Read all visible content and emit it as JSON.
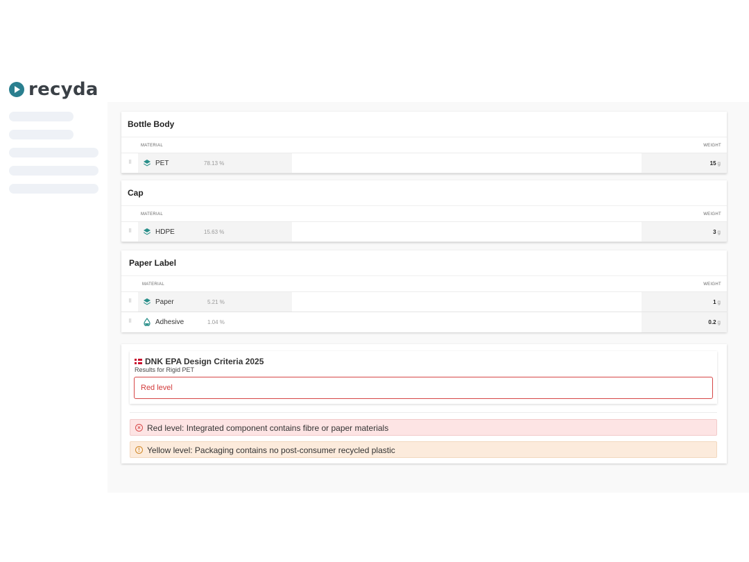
{
  "brand": {
    "name": "recyda",
    "accent": "#2a7f8f"
  },
  "components": [
    {
      "title": "Bottle Body",
      "material_header": "MATERIAL",
      "weight_header": "WEIGHT",
      "rows": [
        {
          "icon": "layers-icon",
          "name": "PET",
          "pct": "78.13 %",
          "weight": "15",
          "unit": "g"
        }
      ]
    },
    {
      "title": "Cap",
      "material_header": "MATERIAL",
      "weight_header": "WEIGHT",
      "rows": [
        {
          "icon": "layers-icon",
          "name": "HDPE",
          "pct": "15.63 %",
          "weight": "3",
          "unit": "g"
        }
      ]
    },
    {
      "title": "Paper Label",
      "material_header": "MATERIAL",
      "weight_header": "WEIGHT",
      "rows": [
        {
          "icon": "layers-icon",
          "name": "Paper",
          "pct": "5.21 %",
          "weight": "1",
          "unit": "g"
        },
        {
          "icon": "drop-icon",
          "name": "Adhesive",
          "pct": "1.04 %",
          "weight": "0.2",
          "unit": "g"
        }
      ]
    }
  ],
  "criteria": {
    "title": "DNK EPA Design Criteria 2025",
    "subtitle": "Results for Rigid PET",
    "level": "Red level",
    "level_color": "#d23c3c"
  },
  "messages": [
    {
      "type": "red",
      "icon": "x-circle-icon",
      "text": "Red level: Integrated component contains fibre or paper materials"
    },
    {
      "type": "yellow",
      "icon": "info-circle-icon",
      "text": "Yellow level: Packaging contains no post-consumer recycled plastic"
    }
  ]
}
